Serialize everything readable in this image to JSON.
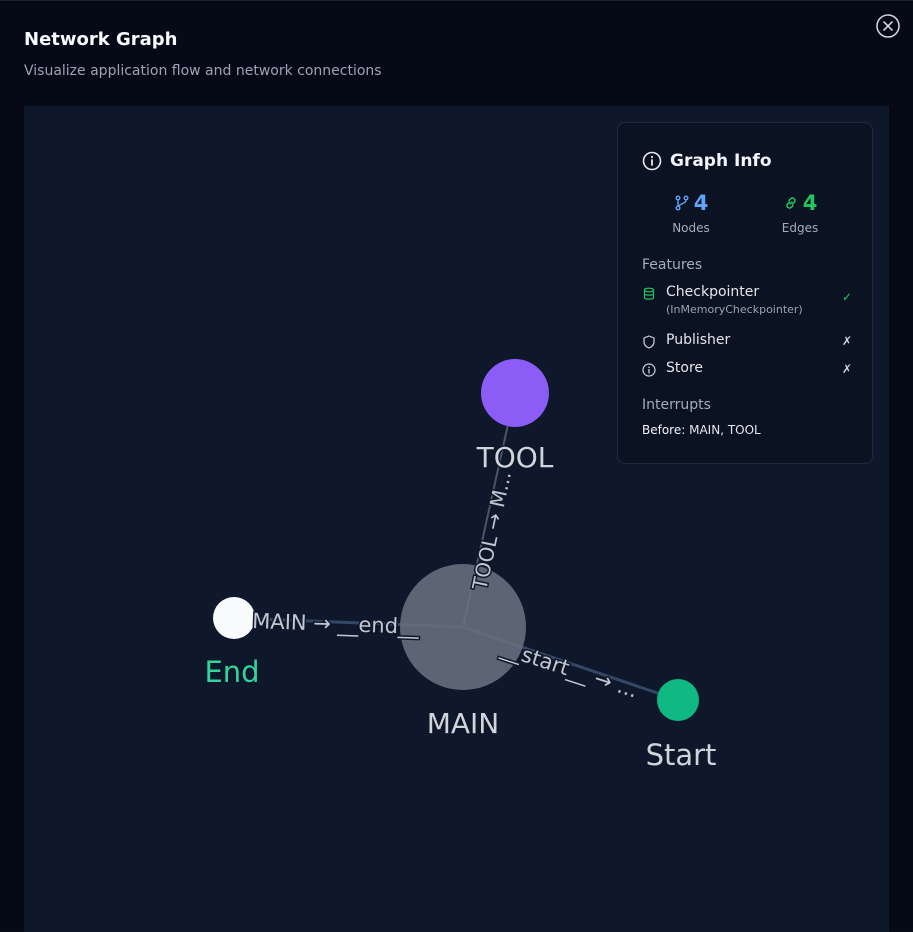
{
  "header": {
    "title": "Network Graph",
    "subtitle": "Visualize application flow and network connections"
  },
  "graph": {
    "nodes": [
      {
        "id": "tool",
        "label": "TOOL",
        "color": "#8b5cf6",
        "label_color": "#d1d5db"
      },
      {
        "id": "main",
        "label": "MAIN",
        "color": "#6b7280",
        "label_color": "#d1d5db"
      },
      {
        "id": "end",
        "label": "End",
        "color": "#f8fafc",
        "label_color": "#34d399"
      },
      {
        "id": "start",
        "label": "Start",
        "color": "#10b981",
        "label_color": "#d1d5db"
      }
    ],
    "edges": [
      {
        "from": "main",
        "to": "tool",
        "label": "TOOL → M..."
      },
      {
        "from": "main",
        "to": "end",
        "label": "MAIN → __end__"
      },
      {
        "from": "start",
        "to": "main",
        "label": "__start__ → ..."
      }
    ]
  },
  "info": {
    "title": "Graph Info",
    "nodes_count": "4",
    "nodes_label": "Nodes",
    "edges_count": "4",
    "edges_label": "Edges",
    "features_label": "Features",
    "features": [
      {
        "name": "Checkpointer",
        "detail": "(InMemoryCheckpointer)",
        "mark": "✓",
        "icon": "database-icon"
      },
      {
        "name": "Publisher",
        "mark": "✗",
        "icon": "shield-icon"
      },
      {
        "name": "Store",
        "mark": "✗",
        "icon": "info-icon"
      }
    ],
    "interrupts_label": "Interrupts",
    "interrupts_prefix": "Before:",
    "interrupts_value": "MAIN, TOOL"
  },
  "colors": {
    "nodes_accent": "#60a5fa",
    "edges_accent": "#22c55e",
    "check": "#22c55e"
  }
}
